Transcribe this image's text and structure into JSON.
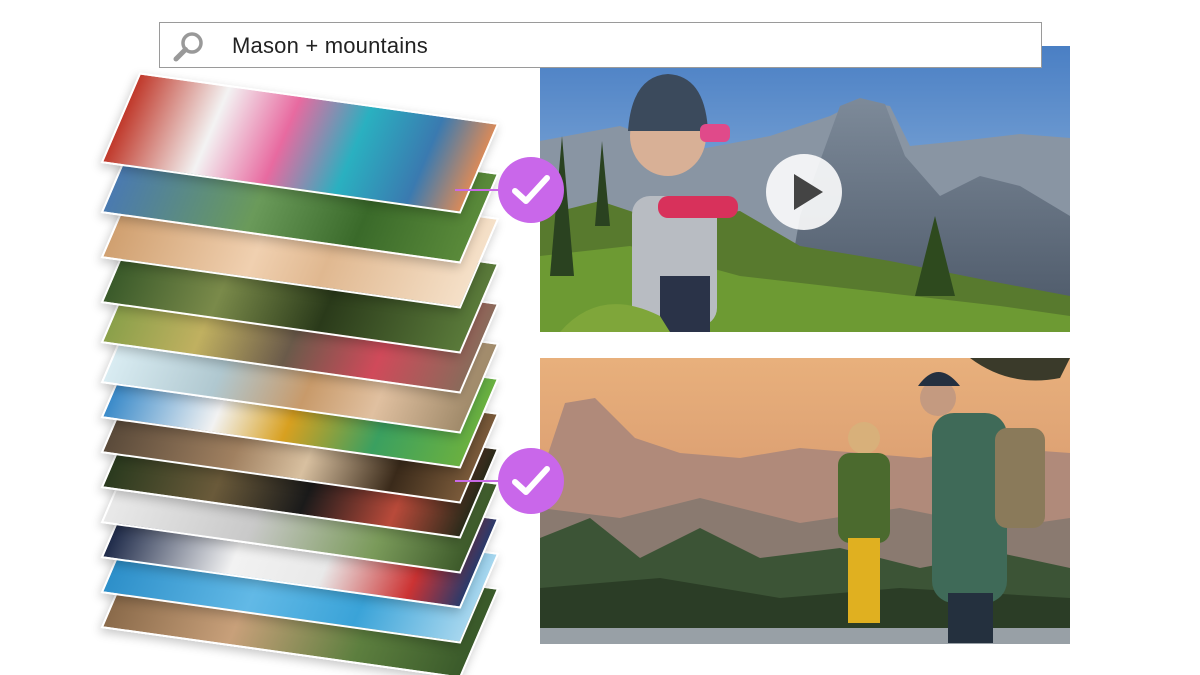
{
  "search": {
    "query": "Mason + mountains"
  },
  "icons": {
    "search": "search-icon",
    "check": "checkmark-icon",
    "play": "play-icon"
  },
  "colors": {
    "accent": "#c967ea",
    "search_border": "#9a9a9a"
  },
  "stack_photos": [
    "photo-playground",
    "photo-child-smile",
    "photo-mountain-trail",
    "photo-family-picnic",
    "photo-kids-swing",
    "photo-car-ride",
    "photo-family-night",
    "photo-baby-blanket",
    "photo-beach",
    "photo-pool",
    "photo-garden",
    "photo-backpack"
  ],
  "results": [
    {
      "name": "video-child-binoculars-yosemite",
      "matched": true,
      "has_play_button": true
    },
    {
      "name": "photo-child-father-half-dome",
      "matched": true,
      "has_play_button": false
    }
  ]
}
